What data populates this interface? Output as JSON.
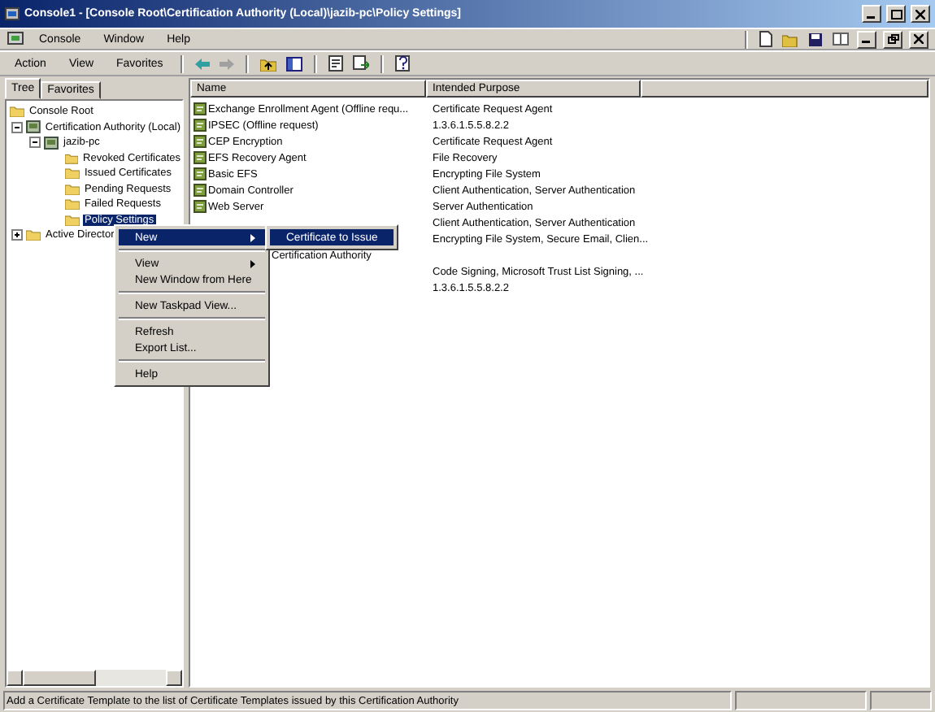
{
  "window": {
    "title": "Console1 - [Console Root\\Certification Authority (Local)\\jazib-pc\\Policy Settings]"
  },
  "menu_bar": [
    "Console",
    "Window",
    "Help"
  ],
  "action_bar": [
    "Action",
    "View",
    "Favorites"
  ],
  "tabs": [
    {
      "label": "Tree",
      "selected": true
    },
    {
      "label": "Favorites",
      "selected": false
    }
  ],
  "tree": [
    {
      "label": "Console Root",
      "selected": false,
      "children": [
        {
          "label": "Certification Authority (Local)",
          "selected": false,
          "expanded": true,
          "children": [
            {
              "label": "jazib-pc",
              "selected": false,
              "expanded": true,
              "children": [
                {
                  "label": "Revoked Certificates",
                  "selected": false
                },
                {
                  "label": "Issued Certificates",
                  "selected": false
                },
                {
                  "label": "Pending Requests",
                  "selected": false
                },
                {
                  "label": "Failed Requests",
                  "selected": false
                },
                {
                  "label": "Policy Settings",
                  "selected": true
                }
              ]
            }
          ]
        },
        {
          "label": "Active Director",
          "selected": false,
          "expanded": false
        }
      ]
    }
  ],
  "columns": [
    "Name",
    "Intended Purpose"
  ],
  "rows": [
    {
      "name": "Exchange Enrollment Agent (Offline requ...",
      "purpose": "Certificate Request Agent"
    },
    {
      "name": "IPSEC (Offline request)",
      "purpose": "1.3.6.1.5.5.8.2.2"
    },
    {
      "name": "CEP Encryption",
      "purpose": "Certificate Request Agent"
    },
    {
      "name": "EFS Recovery Agent",
      "purpose": "File Recovery"
    },
    {
      "name": "Basic EFS",
      "purpose": "Encrypting File System"
    },
    {
      "name": "Domain Controller",
      "purpose": "Client Authentication, Server Authentication"
    },
    {
      "name": "Web Server",
      "purpose": "Server Authentication"
    },
    {
      "purpose": "Client Authentication, Server Authentication"
    },
    {
      "purpose": "Encrypting File System, Secure Email, Clien..."
    },
    {
      "covered": true,
      "name": "Certification Authority"
    },
    {
      "purpose": "Code Signing, Microsoft Trust List Signing, ..."
    },
    {
      "purpose": "1.3.6.1.5.5.8.2.2"
    }
  ],
  "context_menu": [
    {
      "kind": "item",
      "label": "New",
      "submenu": true,
      "selected": true
    },
    {
      "kind": "separator"
    },
    {
      "kind": "item",
      "label": "View",
      "submenu": true,
      "selected": false
    },
    {
      "kind": "item",
      "label": "New Window from Here",
      "submenu": false,
      "selected": false
    },
    {
      "kind": "separator"
    },
    {
      "kind": "item",
      "label": "New Taskpad View...",
      "submenu": false,
      "selected": false
    },
    {
      "kind": "separator"
    },
    {
      "kind": "item",
      "label": "Refresh",
      "submenu": false,
      "selected": false
    },
    {
      "kind": "item",
      "label": "Export List...",
      "submenu": false,
      "selected": false
    },
    {
      "kind": "separator"
    },
    {
      "kind": "item",
      "label": "Help",
      "submenu": false,
      "selected": false
    }
  ],
  "submenu": [
    {
      "label": "Certificate to Issue",
      "selected": true
    }
  ],
  "status_bar": "Add a Certificate Template to the list of Certificate Templates issued by this Certification Authority"
}
